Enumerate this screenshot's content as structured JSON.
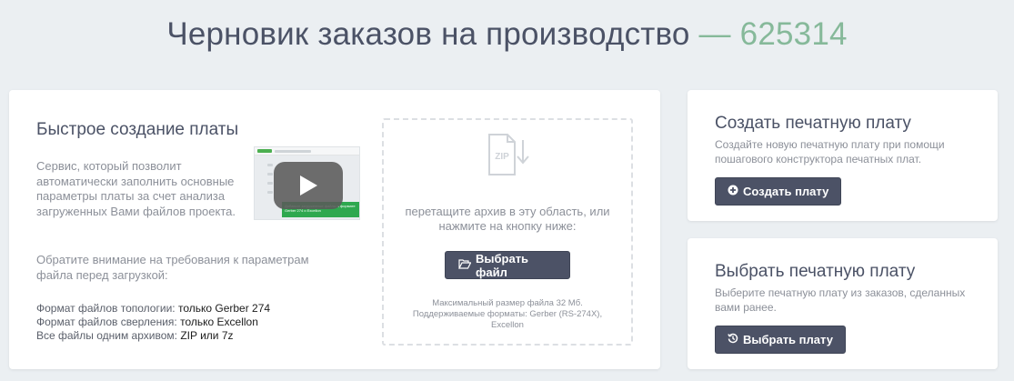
{
  "header": {
    "title": "Черновик заказов на производство",
    "order_number": "— 625314"
  },
  "quick": {
    "title": "Быстрое создание платы",
    "description": "Сервис, который позволит автоматически заполнить основные параметры платы за счет анализа загруженных Вами файлов проекта.",
    "notice": "Обратите внимание на требования к параметрам файла перед загрузкой:",
    "formats": [
      {
        "label": "Формат файлов топологии:",
        "value": "только Gerber 274"
      },
      {
        "label": "Формат файлов сверления:",
        "value": "только Excellon"
      },
      {
        "label": "Все файлы одним архивом:",
        "value": "ZIP или 7z"
      }
    ],
    "video": {
      "banner_text": "Добавьте загруженные файлы в формате Gerber 274 и Excellon",
      "play_icon": "play-icon"
    }
  },
  "dropzone": {
    "icon": "zip-file-icon",
    "zip_label": "ZIP",
    "text": "перетащите архив в эту область, или нажмите на кнопку ниже:",
    "button_icon": "folder-open-icon",
    "button_label": "Выбрать файл",
    "limit_size": "Максимальный размер файла 32 Мб.",
    "limit_formats": "Поддерживаемые форматы: Gerber (RS-274X), Excellon"
  },
  "create_card": {
    "title": "Создать печатную плату",
    "description": "Создайте новую печатную плату при помощи пошагового конструктора печатных плат.",
    "button_icon": "plus-circle-icon",
    "button_label": "Создать плату"
  },
  "select_card": {
    "title": "Выбрать печатную плату",
    "description": "Выберите печатную плату из заказов, сделанных вами ранее.",
    "button_icon": "history-icon",
    "button_label": "Выбрать плату"
  },
  "colors": {
    "background": "#ebeff2",
    "accent_green": "#86b99a",
    "button": "#4c5266"
  }
}
